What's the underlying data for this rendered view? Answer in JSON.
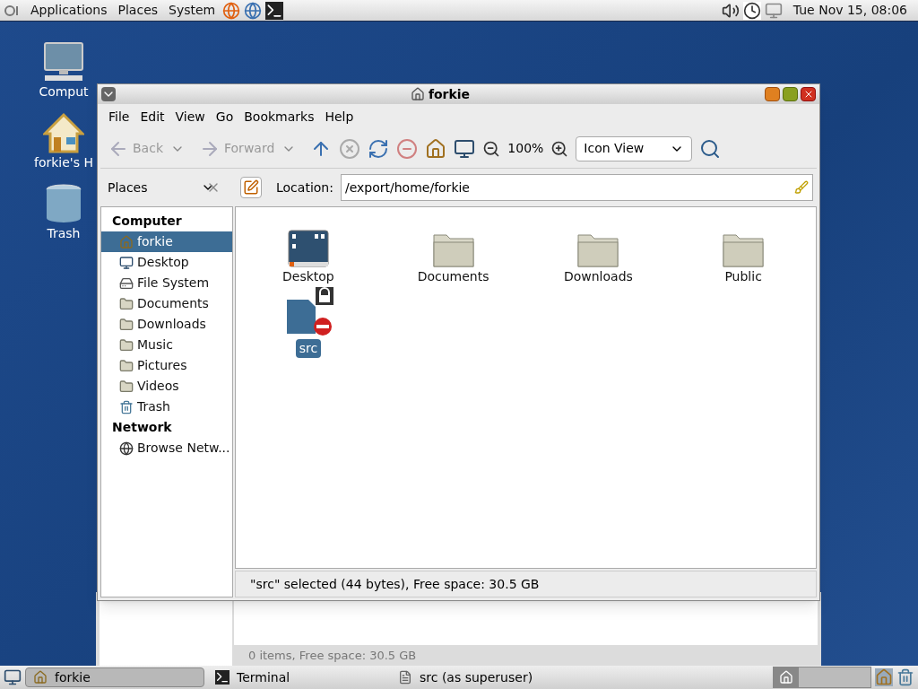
{
  "top_panel": {
    "menus": [
      "Applications",
      "Places",
      "System"
    ],
    "clock": "Tue Nov 15, 08:06"
  },
  "desktop_icons": [
    {
      "kind": "computer",
      "label": "Comput"
    },
    {
      "kind": "home",
      "label": "forkie's H"
    },
    {
      "kind": "trash",
      "label": "Trash"
    }
  ],
  "background_window": {
    "status": "0 items, Free space: 30.5 GB"
  },
  "window": {
    "title": "forkie",
    "menu": [
      "File",
      "Edit",
      "View",
      "Go",
      "Bookmarks",
      "Help"
    ],
    "toolbar": {
      "back": {
        "label": "Back",
        "disabled": true
      },
      "forward": {
        "label": "Forward",
        "disabled": true
      },
      "zoom": "100%",
      "view": "Icon View"
    },
    "pane_selector": "Places",
    "location_label": "Location:",
    "location": "/export/home/forkie",
    "sidebar": [
      {
        "heading": "Computer",
        "items": [
          {
            "kind": "home",
            "label": "forkie",
            "selected": true
          },
          {
            "kind": "desktop",
            "label": "Desktop",
            "selected": false
          },
          {
            "kind": "drive",
            "label": "File System",
            "selected": false
          },
          {
            "kind": "folder",
            "label": "Documents",
            "selected": false
          },
          {
            "kind": "folder",
            "label": "Downloads",
            "selected": false
          },
          {
            "kind": "folder",
            "label": "Music",
            "selected": false
          },
          {
            "kind": "folder",
            "label": "Pictures",
            "selected": false
          },
          {
            "kind": "folder",
            "label": "Videos",
            "selected": false
          },
          {
            "kind": "trash",
            "label": "Trash",
            "selected": false
          }
        ]
      },
      {
        "heading": "Network",
        "items": [
          {
            "kind": "network",
            "label": "Browse Netw...",
            "selected": false
          }
        ]
      }
    ],
    "files": [
      {
        "kind": "desktop",
        "name": "Desktop",
        "selected": false
      },
      {
        "kind": "folder",
        "name": "Documents",
        "selected": false
      },
      {
        "kind": "folder",
        "name": "Downloads",
        "selected": false
      },
      {
        "kind": "folder",
        "name": "Public",
        "selected": false
      },
      {
        "kind": "locked-file",
        "name": "src",
        "selected": true
      }
    ],
    "status": "\"src\" selected (44 bytes), Free space: 30.5 GB"
  },
  "taskbar": {
    "tasks": [
      {
        "kind": "home",
        "label": "forkie",
        "selected": true
      },
      {
        "kind": "terminal",
        "label": "Terminal",
        "selected": false
      },
      {
        "kind": "file",
        "label": "src (as superuser)",
        "selected": false
      }
    ]
  }
}
